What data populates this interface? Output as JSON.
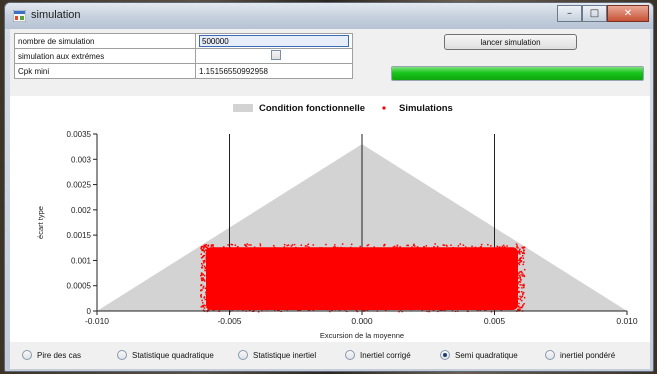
{
  "window": {
    "title": "simulation",
    "minimize": "–",
    "maximize": "□",
    "close": "✕"
  },
  "params": {
    "n_sim_label": "nombre de simulation",
    "n_sim_value": "500000",
    "extremes_label": "simulation aux extrémes",
    "extremes_checked": false,
    "cpk_label": "Cpk mini",
    "cpk_value": "1.15156550992958"
  },
  "launch_label": "lancer simulation",
  "progress": {
    "fraction": 1.0,
    "color": "#18c51a"
  },
  "chart_data": {
    "type": "scatter",
    "legend": [
      {
        "label": "Condition fonctionnelle",
        "color": "#d3d3d3",
        "kind": "area"
      },
      {
        "label": "Simulations",
        "color": "#ff0000",
        "kind": "point"
      }
    ],
    "legend_position": "top",
    "xlabel": "Excursion de la moyenne",
    "ylabel": "écart type",
    "xlim": [
      -0.01,
      0.01
    ],
    "ylim": [
      0,
      0.0035
    ],
    "xticks": [
      "-0.010",
      "-0.005",
      "0.000",
      "0.005",
      "0.010"
    ],
    "yticks": [
      "0",
      "0.0005",
      "0.001",
      "0.0015",
      "0.002",
      "0.0025",
      "0.003",
      "0.0035"
    ],
    "ytick_values": [
      0,
      0.0005,
      0.001,
      0.0015,
      0.002,
      0.0025,
      0.003,
      0.0035
    ],
    "xtick_values": [
      -0.01,
      -0.005,
      0,
      0.005,
      0.01
    ],
    "grid_x": [
      -0.005,
      0,
      0.005
    ],
    "grid_y": [],
    "functional_condition": {
      "x": [
        -0.01,
        0,
        0.01
      ],
      "y": [
        0,
        0.0033,
        0
      ]
    },
    "simulations": {
      "x_range": [
        -0.006,
        0.006
      ],
      "y_range": [
        0,
        0.0013
      ]
    }
  },
  "methods": [
    {
      "label": "Pire des cas",
      "selected": false
    },
    {
      "label": "Statistique quadratique",
      "selected": false
    },
    {
      "label": "Statistique inertiel",
      "selected": false
    },
    {
      "label": "Inertiel corrigé",
      "selected": false
    },
    {
      "label": "Semi quadratique",
      "selected": true
    },
    {
      "label": "inertiel pondéré",
      "selected": false
    }
  ],
  "colors": {
    "scatter": "#ff0000",
    "area": "#d3d3d3",
    "accent": "#3d6ab5"
  }
}
